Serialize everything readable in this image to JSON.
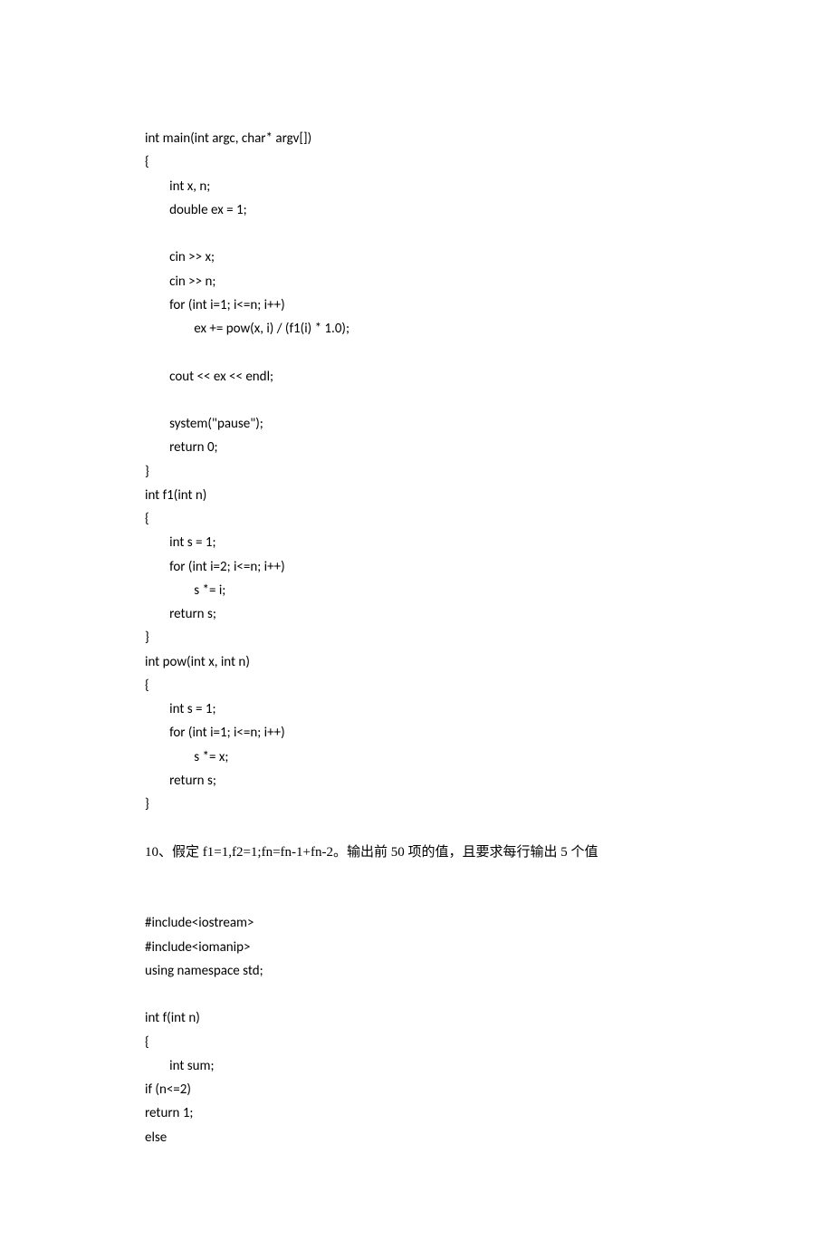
{
  "code1": [
    "int main(int argc, char* argv[])",
    "{",
    "        int x, n;",
    "        double ex = 1;",
    "",
    "        cin >> x;",
    "        cin >> n;",
    "        for (int i=1; i<=n; i++)",
    "                ex += pow(x, i) / (f1(i) * 1.0);",
    "",
    "        cout << ex << endl;",
    "",
    "        system(\"pause\");",
    "        return 0;",
    "}",
    "int f1(int n)",
    "{",
    "        int s = 1;",
    "        for (int i=2; i<=n; i++)",
    "                s *= i;",
    "        return s;",
    "}",
    "int pow(int x, int n)",
    "{",
    "        int s = 1;",
    "        for (int i=1; i<=n; i++)",
    "                s *= x;",
    "        return s;",
    "}"
  ],
  "question": "10、假定 f1=1,f2=1;fn=fn-1+fn-2。输出前 50 项的值，且要求每行输出 5 个值",
  "code2": [
    "#include<iostream>",
    "#include<iomanip>",
    "using namespace std;",
    "",
    "int f(int n)",
    "{",
    "        int sum;",
    "if (n<=2)",
    "return 1;",
    "else"
  ]
}
